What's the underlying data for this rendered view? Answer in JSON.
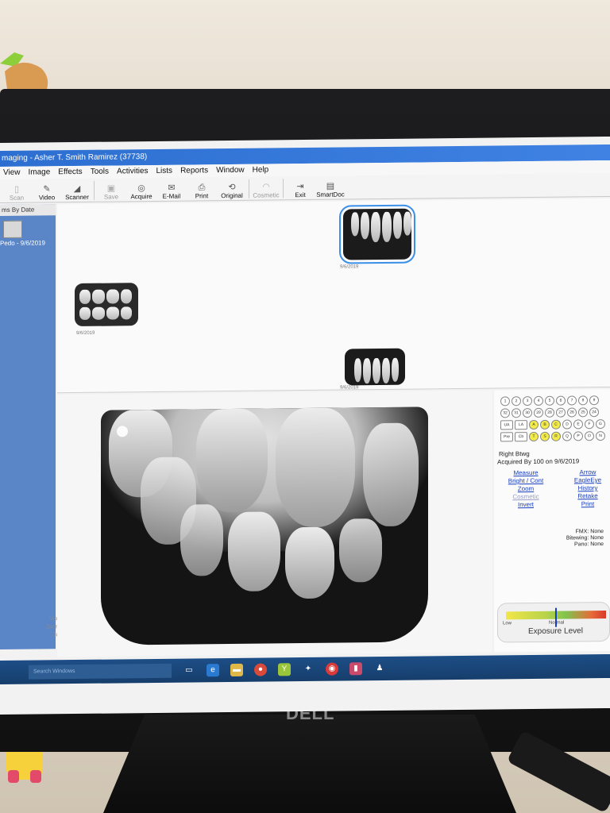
{
  "window": {
    "title": "maging - Asher T. Smith Ramirez (37738)"
  },
  "menu": [
    "View",
    "Image",
    "Effects",
    "Tools",
    "Activities",
    "Lists",
    "Reports",
    "Window",
    "Help"
  ],
  "toolbar": {
    "items": [
      {
        "label": "Scan",
        "icon": "scan-icon",
        "glyph": "▯",
        "enabled": false
      },
      {
        "label": "Video",
        "icon": "video-icon",
        "glyph": "✎",
        "enabled": true
      },
      {
        "label": "Scanner",
        "icon": "scanner-icon",
        "glyph": "◢",
        "enabled": true
      },
      {
        "label": "Save",
        "icon": "save-icon",
        "glyph": "▣",
        "enabled": false
      },
      {
        "label": "Acquire",
        "icon": "acquire-icon",
        "glyph": "◎",
        "enabled": true
      },
      {
        "label": "E-Mail",
        "icon": "email-icon",
        "glyph": "✉",
        "enabled": true
      },
      {
        "label": "Print",
        "icon": "print-icon",
        "glyph": "⎙",
        "enabled": true
      },
      {
        "label": "Original",
        "icon": "original-icon",
        "glyph": "⟲",
        "enabled": true
      },
      {
        "label": "Cosmetic",
        "icon": "cosmetic-icon",
        "glyph": "◠",
        "enabled": false
      },
      {
        "label": "Exit",
        "icon": "exit-icon",
        "glyph": "⇥",
        "enabled": true
      },
      {
        "label": "SmartDoc",
        "icon": "smartdoc-icon",
        "glyph": "▤",
        "enabled": true
      }
    ]
  },
  "left_panel": {
    "header": "ms By Date",
    "item": "Pedo - 9/6/2019",
    "footer": [
      "View Exam",
      "Zoom To Type",
      "Zoom Fit"
    ]
  },
  "thumbnails": [
    {
      "date": "9/6/2019",
      "selected": true
    },
    {
      "date": "9/6/2019",
      "selected": false
    },
    {
      "date": "9/6/2019",
      "selected": false
    }
  ],
  "tooth_chart": {
    "row1": [
      "1",
      "2",
      "3",
      "4",
      "5",
      "6",
      "7",
      "8",
      "9"
    ],
    "row2": [
      "32",
      "31",
      "30",
      "29",
      "28",
      "27",
      "26",
      "25",
      "24"
    ],
    "row3": [
      {
        "t": "UA",
        "sq": true
      },
      {
        "t": "LA",
        "sq": true
      },
      {
        "t": "A",
        "hl": true
      },
      {
        "t": "B",
        "hl": true
      },
      {
        "t": "C",
        "hl": true
      },
      {
        "t": "D"
      },
      {
        "t": "E"
      },
      {
        "t": "F"
      },
      {
        "t": "G"
      }
    ],
    "row4": [
      {
        "t": "Pre",
        "sq": true
      },
      {
        "t": "Cb",
        "sq": true
      },
      {
        "t": "T",
        "hl": true
      },
      {
        "t": "S",
        "hl": true
      },
      {
        "t": "R",
        "hl": true
      },
      {
        "t": "Q"
      },
      {
        "t": "P"
      },
      {
        "t": "O"
      },
      {
        "t": "N"
      }
    ]
  },
  "info": {
    "region": "Right Btwg",
    "acquired": "Acquired By 100 on 9/6/2019",
    "links_left": [
      {
        "label": "Measure",
        "enabled": true
      },
      {
        "label": "Bright / Cont",
        "enabled": true
      },
      {
        "label": "Zoom",
        "enabled": true
      },
      {
        "label": "Cosmetic",
        "enabled": false
      },
      {
        "label": "Invert",
        "enabled": true
      }
    ],
    "links_right": [
      {
        "label": "Arrow",
        "enabled": true
      },
      {
        "label": "EagleEye",
        "enabled": true
      },
      {
        "label": "History",
        "enabled": true
      },
      {
        "label": "Retake",
        "enabled": true
      },
      {
        "label": "Print",
        "enabled": true
      }
    ],
    "series": [
      "FMX: None",
      "Bitewing: None",
      "Pano: None"
    ]
  },
  "exposure": {
    "title": "Exposure Level",
    "low": "Low",
    "normal": "Normal"
  },
  "taskbar": {
    "search_placeholder": "Search Windows"
  },
  "monitor": {
    "brand": "DELL"
  }
}
